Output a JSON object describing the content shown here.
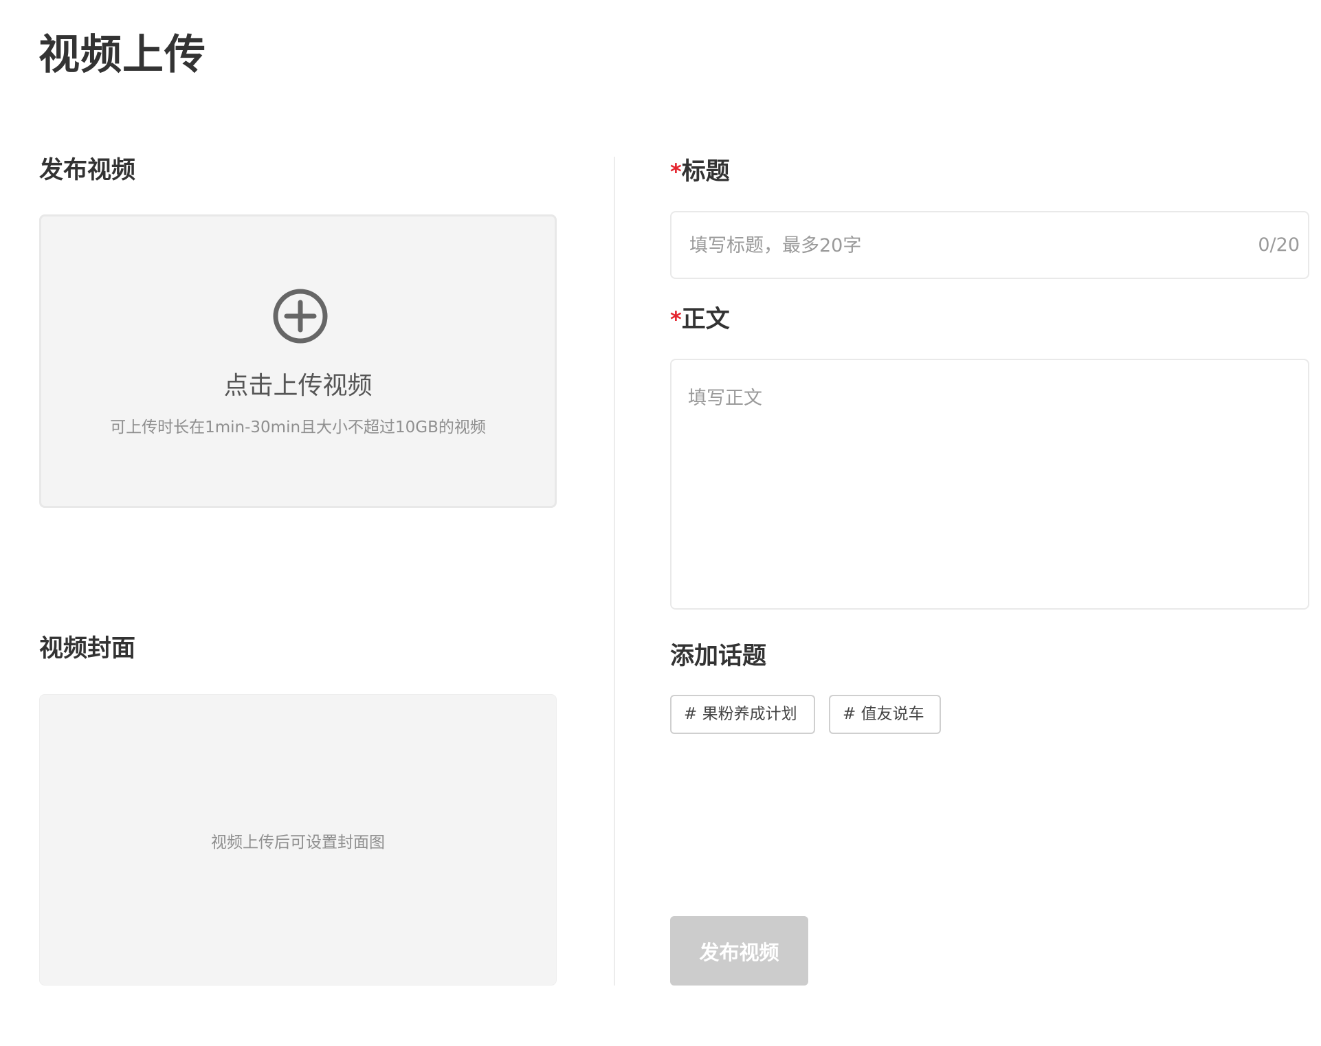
{
  "page": {
    "title": "视频上传"
  },
  "left": {
    "publish_section_label": "发布视频",
    "upload": {
      "icon": "plus-circle-icon",
      "main_text": "点击上传视频",
      "sub_text": "可上传时长在1min-30min且大小不超过10GB的视频"
    },
    "cover_section_label": "视频封面",
    "cover": {
      "hint": "视频上传后可设置封面图"
    }
  },
  "form": {
    "required_mark": "*",
    "title_label": "标题",
    "title_placeholder": "填写标题，最多20字",
    "title_value": "",
    "title_count": "0/20",
    "body_label": "正文",
    "body_placeholder": "填写正文",
    "body_value": "",
    "topics_label": "添加话题",
    "topics": [
      "# 果粉养成计划",
      "# 值友说车"
    ],
    "publish_button": "发布视频"
  },
  "colors": {
    "required_star": "#e4242e",
    "button_disabled_bg": "#cccccc",
    "upload_box_bg": "#f4f4f4"
  }
}
